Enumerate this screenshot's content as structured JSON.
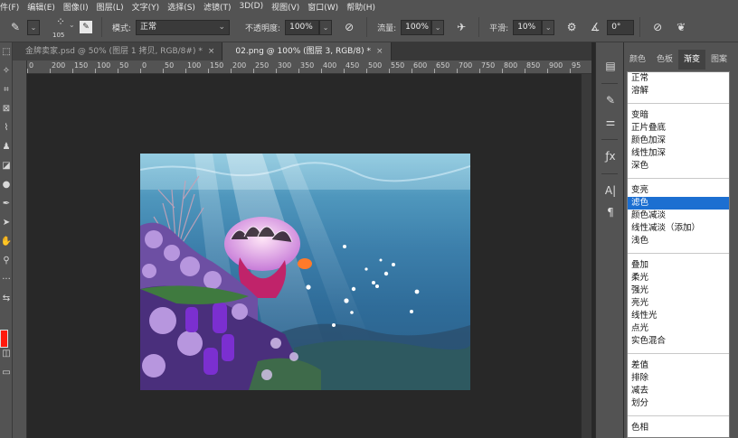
{
  "menu": [
    "件(F)",
    "编辑(E)",
    "图像(I)",
    "图层(L)",
    "文字(Y)",
    "选择(S)",
    "滤镜(T)",
    "3D(D)",
    "视图(V)",
    "窗口(W)",
    "帮助(H)"
  ],
  "options": {
    "brush_size": "105",
    "mode_label": "模式:",
    "mode_value": "正常",
    "opacity_label": "不透明度:",
    "opacity_value": "100%",
    "flow_label": "流量:",
    "flow_value": "100%",
    "smoothing_label": "平滑:",
    "smoothing_value": "10%",
    "angle_value": "0°"
  },
  "tabs": [
    {
      "label": "金牌卖家.psd @ 50% (图层 1 拷贝, RGB/8#) *",
      "active": false
    },
    {
      "label": "02.png @ 100% (图层 3, RGB/8) *",
      "active": true
    }
  ],
  "ruler_marks": [
    "0",
    "200",
    "150",
    "100",
    "50",
    "0",
    "50",
    "100",
    "150",
    "200",
    "250",
    "300",
    "350",
    "400",
    "450",
    "500",
    "550",
    "600",
    "650",
    "700",
    "750",
    "800",
    "850",
    "900",
    "95"
  ],
  "panel_tabs": [
    {
      "label": "颜色",
      "active": false
    },
    {
      "label": "色板",
      "active": false
    },
    {
      "label": "渐变",
      "active": true
    },
    {
      "label": "图案",
      "active": false
    }
  ],
  "blend_modes": {
    "group1": [
      "正常",
      "溶解"
    ],
    "group2": [
      "变暗",
      "正片叠底",
      "颜色加深",
      "线性加深",
      "深色"
    ],
    "group3": [
      "变亮",
      "滤色",
      "颜色减淡",
      "线性减淡（添加）",
      "浅色"
    ],
    "group4": [
      "叠加",
      "柔光",
      "强光",
      "亮光",
      "线性光",
      "点光",
      "实色混合"
    ],
    "group5": [
      "差值",
      "排除",
      "减去",
      "划分"
    ],
    "group6": [
      "色相"
    ],
    "selected": "滤色"
  },
  "colors": {
    "foreground": "#ff1a0d",
    "selection": "#1c6fd1"
  }
}
